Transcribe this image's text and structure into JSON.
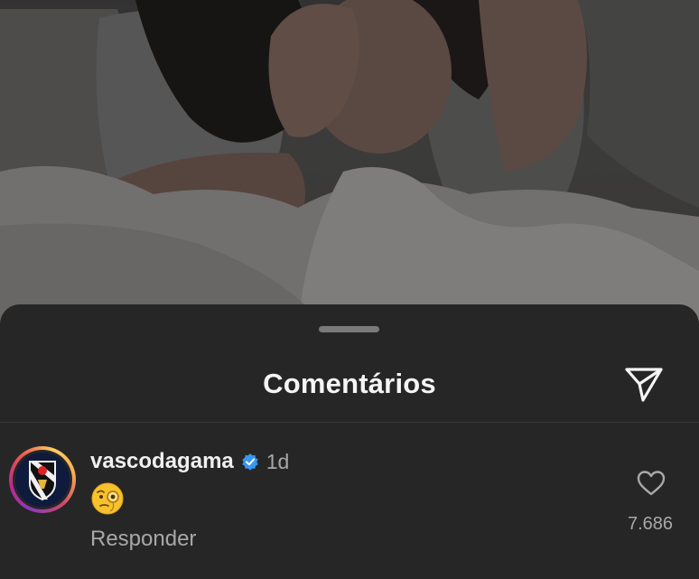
{
  "sheet": {
    "title": "Comentários",
    "share_icon": "send-icon"
  },
  "comments": [
    {
      "username": "vascodagama",
      "verified": true,
      "time": "1d",
      "emoji": "face-with-monocle",
      "reply_label": "Responder",
      "like_icon": "heart-icon",
      "like_count": "7.686"
    }
  ],
  "colors": {
    "sheet_background": "#262626",
    "primary_text": "#f5f5f5",
    "secondary_text": "#a8a8a8",
    "verified_blue": "#3897f0"
  }
}
